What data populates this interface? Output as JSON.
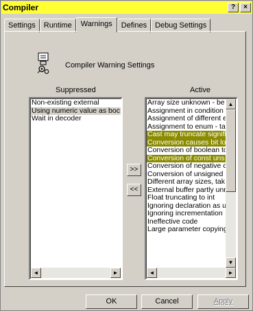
{
  "window": {
    "title": "Compiler",
    "help_label": "?",
    "close_label": "×"
  },
  "tabs": [
    {
      "label": "Settings"
    },
    {
      "label": "Runtime"
    },
    {
      "label": "Warnings"
    },
    {
      "label": "Defines"
    },
    {
      "label": "Debug Settings"
    }
  ],
  "header": {
    "label": "Compiler Warning Settings"
  },
  "suppressed": {
    "label": "Suppressed",
    "items": [
      "Non-existing external",
      "Using numeric value as boc",
      "Wait in decoder"
    ]
  },
  "active": {
    "label": "Active",
    "items": [
      "Array size unknown - be",
      "Assignment in condition",
      "Assignment of different e",
      "Assignment to enum - ta",
      "Cast may truncate signifi",
      "Conversion causes bit lo",
      "Conversion of boolean to",
      "Conversion of const uns",
      "Conversion of negative c",
      "Conversion of unsigned",
      "Different array sizes, tak",
      "External buffer partly unr",
      "Float truncating to int",
      "Ignoring declaration as u",
      "Ignoring incrementation",
      "Ineffective code",
      "Large parameter copying"
    ]
  },
  "move": {
    "to_active": ">>",
    "to_suppressed": "<<"
  },
  "buttons": {
    "ok": "OK",
    "cancel": "Cancel",
    "apply": "Apply"
  },
  "scroll": {
    "left": "◄",
    "right": "►",
    "up": "▲",
    "down": "▼"
  }
}
